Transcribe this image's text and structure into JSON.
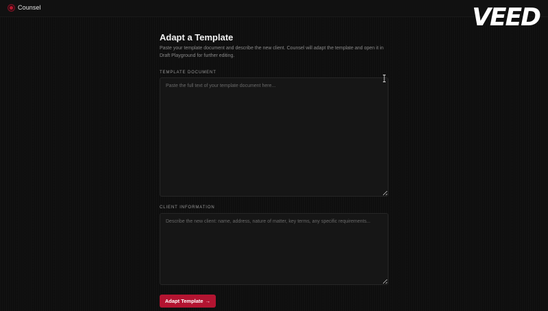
{
  "app": {
    "name": "Counsel",
    "watermark": "VEED"
  },
  "colors": {
    "accent": "#b31431",
    "background": "#0e0e0e",
    "field": "#161616"
  },
  "form": {
    "title": "Adapt a Template",
    "subtitle": "Paste your template document and describe the new client. Counsel will adapt the template and open it in Draft Playground for further editing.",
    "template_label": "Template Document",
    "template_placeholder": "Paste the full text of your template document here...",
    "template_value": "",
    "client_label": "Client Information",
    "client_placeholder": "Describe the new client: name, address, nature of matter, key terms, any specific requirements...",
    "client_value": "",
    "submit_label": "Adapt Template",
    "submit_arrow": "→"
  },
  "icons": {
    "logo": "counsel-logo-icon",
    "cursor": "text-cursor-icon",
    "arrow": "arrow-right-icon"
  }
}
